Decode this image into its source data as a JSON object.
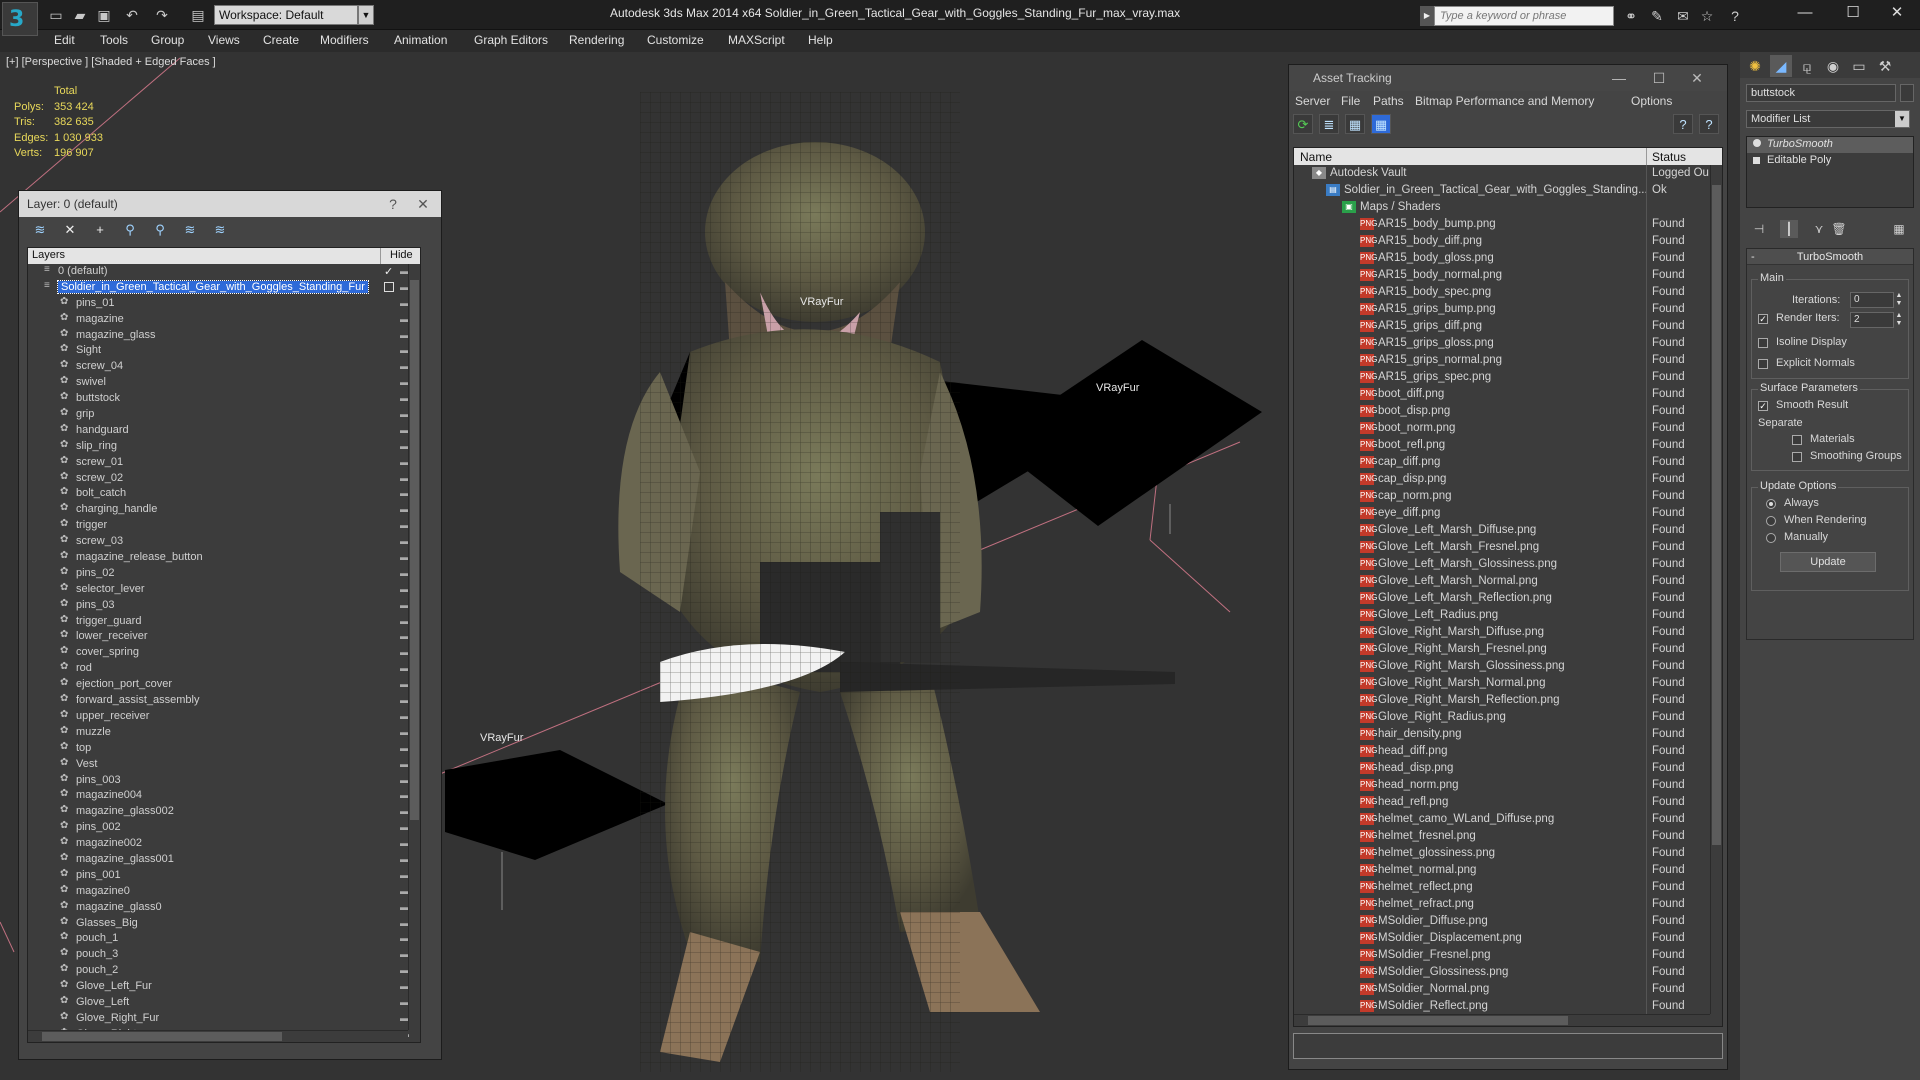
{
  "app": {
    "title": "Autodesk 3ds Max  2014 x64      Soldier_in_Green_Tactical_Gear_with_Goggles_Standing_Fur_max_vray.max",
    "workspace": "Workspace: Default",
    "search_placeholder": "Type a keyword or phrase",
    "accent": "#27a8c8"
  },
  "menu": [
    "Edit",
    "Tools",
    "Group",
    "Views",
    "Create",
    "Modifiers",
    "Animation",
    "Graph Editors",
    "Rendering",
    "Customize",
    "MAXScript",
    "Help"
  ],
  "viewport": {
    "label": "[+] [Perspective ] [Shaded + Edged Faces ]",
    "stats": {
      "header": "Total",
      "rows": [
        {
          "k": "Polys:",
          "v": "353 424"
        },
        {
          "k": "Tris:",
          "v": "382 635"
        },
        {
          "k": "Edges:",
          "v": "1 030 933"
        },
        {
          "k": "Verts:",
          "v": "196 907"
        }
      ]
    },
    "vray_labels": [
      "VRayFur",
      "VRayFur",
      "VRayFur"
    ],
    "stats_color": "#e8d85a"
  },
  "layer_panel": {
    "title": "Layer: 0 (default)",
    "help": "?",
    "close": "✕",
    "col_layers": "Layers",
    "col_hide": "Hide",
    "default_layer": "0 (default)",
    "selected_layer": "Soldier_in_Green_Tactical_Gear_with_Goggles_Standing_Fur",
    "objects": [
      "pins_01",
      "magazine",
      "magazine_glass",
      "Sight",
      "screw_04",
      "swivel",
      "buttstock",
      "grip",
      "handguard",
      "slip_ring",
      "screw_01",
      "screw_02",
      "bolt_catch",
      "charging_handle",
      "trigger",
      "screw_03",
      "magazine_release_button",
      "pins_02",
      "selector_lever",
      "pins_03",
      "trigger_guard",
      "lower_receiver",
      "cover_spring",
      "rod",
      "ejection_port_cover",
      "forward_assist_assembly",
      "upper_receiver",
      "muzzle",
      "top",
      "Vest",
      "pins_003",
      "magazine004",
      "magazine_glass002",
      "pins_002",
      "magazine002",
      "magazine_glass001",
      "pins_001",
      "magazine0",
      "magazine_glass0",
      "Glasses_Big",
      "pouch_1",
      "pouch_3",
      "pouch_2",
      "Glove_Left_Fur",
      "Glove_Left",
      "Glove_Right_Fur",
      "Glove_Right"
    ]
  },
  "asset_panel": {
    "title": "Asset Tracking",
    "menu": [
      "Server",
      "File",
      "Paths",
      "Bitmap Performance and Memory",
      "Options"
    ],
    "col_name": "Name",
    "col_status": "Status",
    "vault": {
      "name": "Autodesk Vault",
      "status": "Logged Ou"
    },
    "file": {
      "name": "Soldier_in_Green_Tactical_Gear_with_Goggles_Standing...",
      "status": "Ok"
    },
    "maps": {
      "name": "Maps / Shaders",
      "status": ""
    },
    "found_label": "Found",
    "assets": [
      "AR15_body_bump.png",
      "AR15_body_diff.png",
      "AR15_body_gloss.png",
      "AR15_body_normal.png",
      "AR15_body_spec.png",
      "AR15_grips_bump.png",
      "AR15_grips_diff.png",
      "AR15_grips_gloss.png",
      "AR15_grips_normal.png",
      "AR15_grips_spec.png",
      "boot_diff.png",
      "boot_disp.png",
      "boot_norm.png",
      "boot_refl.png",
      "cap_diff.png",
      "cap_disp.png",
      "cap_norm.png",
      "eye_diff.png",
      "Glove_Left_Marsh_Diffuse.png",
      "Glove_Left_Marsh_Fresnel.png",
      "Glove_Left_Marsh_Glossiness.png",
      "Glove_Left_Marsh_Normal.png",
      "Glove_Left_Marsh_Reflection.png",
      "Glove_Left_Radius.png",
      "Glove_Right_Marsh_Diffuse.png",
      "Glove_Right_Marsh_Fresnel.png",
      "Glove_Right_Marsh_Glossiness.png",
      "Glove_Right_Marsh_Normal.png",
      "Glove_Right_Marsh_Reflection.png",
      "Glove_Right_Radius.png",
      "hair_density.png",
      "head_diff.png",
      "head_disp.png",
      "head_norm.png",
      "head_refl.png",
      "helmet_camo_WLand_Diffuse.png",
      "helmet_fresnel.png",
      "helmet_glossiness.png",
      "helmet_normal.png",
      "helmet_reflect.png",
      "helmet_refract.png",
      "MSoldier_Diffuse.png",
      "MSoldier_Displacement.png",
      "MSoldier_Fresnel.png",
      "MSoldier_Glossiness.png",
      "MSoldier_Normal.png",
      "MSoldier_Reflect.png"
    ]
  },
  "command_panel": {
    "object_name": "buttstock",
    "modifier_list": "Modifier List",
    "stack": [
      "TurboSmooth",
      "Editable Poly"
    ],
    "rollout_title": "TurboSmooth",
    "main_group": "Main",
    "iterations_label": "Iterations:",
    "iterations_value": "0",
    "render_iters_label": "Render Iters:",
    "render_iters_value": "2",
    "isoline": "Isoline Display",
    "explicit": "Explicit Normals",
    "surface_group": "Surface Parameters",
    "smooth_result": "Smooth Result",
    "separate": "Separate",
    "materials": "Materials",
    "smoothing_groups": "Smoothing Groups",
    "update_group": "Update Options",
    "always": "Always",
    "when_rendering": "When Rendering",
    "manually": "Manually",
    "update_button": "Update"
  }
}
